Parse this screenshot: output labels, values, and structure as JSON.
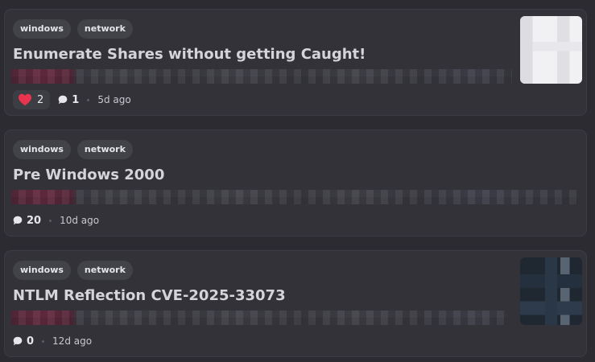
{
  "posts": [
    {
      "tags": [
        "windows",
        "network"
      ],
      "title": "Enumerate Shares without getting Caught!",
      "has_reaction": true,
      "reaction_count": "2",
      "comment_count": "1",
      "time": "5d ago",
      "thumbnail": "light"
    },
    {
      "tags": [
        "windows",
        "network"
      ],
      "title": "Pre Windows 2000",
      "has_reaction": false,
      "comment_count": "20",
      "time": "10d ago",
      "thumbnail": "none"
    },
    {
      "tags": [
        "windows",
        "network"
      ],
      "title": "NTLM Reflection CVE-2025-33073",
      "has_reaction": false,
      "comment_count": "0",
      "time": "12d ago",
      "thumbnail": "dark"
    }
  ],
  "colors": {
    "background": "#2b2b31",
    "card": "#323238",
    "tag": "#424249",
    "heart": "#e8344e"
  }
}
